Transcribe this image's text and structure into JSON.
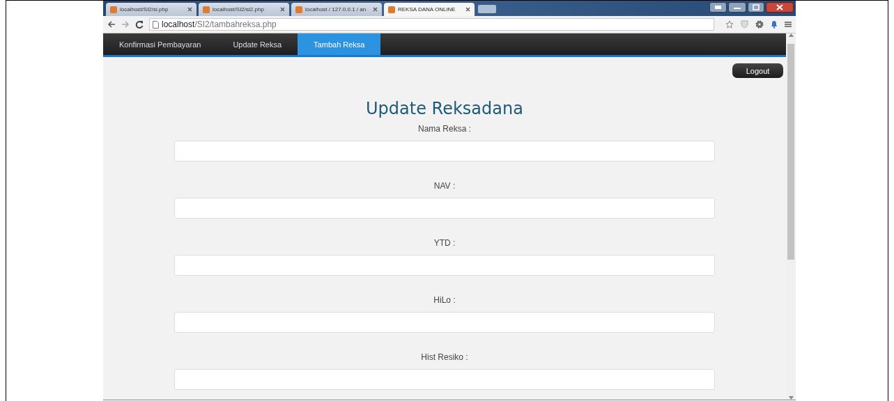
{
  "browser": {
    "tabs": [
      {
        "title": "localhost/SI2/si.php",
        "selected": false
      },
      {
        "title": "localhost/SI2/si2.php",
        "selected": false
      },
      {
        "title": "localhost / 127.0.0.1 / an",
        "selected": false
      },
      {
        "title": "REKSA DANA ONLINE",
        "selected": true
      }
    ],
    "address": "**localhost**/SI2/tambahreksa.php"
  },
  "nav": {
    "items": [
      {
        "label": "Konfirmasi Pembayaran",
        "selected": false
      },
      {
        "label": "Update Reksa",
        "selected": false
      },
      {
        "label": "Tambah Reksa",
        "selected": true
      }
    ]
  },
  "logout": "Logout",
  "heading": "Update Reksadana",
  "fields": [
    {
      "label": "Nama Reksa :"
    },
    {
      "label": "NAV :"
    },
    {
      "label": "YTD :"
    },
    {
      "label": "HiLo :"
    },
    {
      "label": "Hist Resiko :"
    }
  ]
}
